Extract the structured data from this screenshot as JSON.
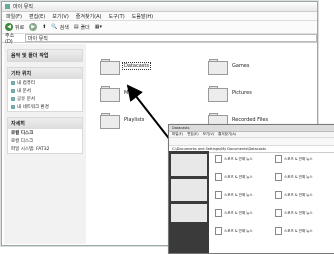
{
  "window": {
    "title": "마이 뮤직",
    "menu": [
      "파일(F)",
      "편집(E)",
      "보기(V)",
      "즐겨찾기(A)",
      "도구(T)",
      "도움말(H)"
    ],
    "toolbar": {
      "back": "뒤로",
      "search": "검색",
      "folders": "폴더"
    },
    "address_label": "주소(D)",
    "address_value": "마이 뮤직"
  },
  "sidebar": {
    "tasks_title": "음악 및 폴더 작업",
    "places_title": "기타 위치",
    "places": [
      "내 컴퓨터",
      "내 문서",
      "공유 문서",
      "내 네트워크 환경"
    ],
    "details_title": "자세히",
    "details_name": "로컬 디스크",
    "details_sub": "로컬 디스크",
    "details_fs": "파일 시스템: FAT32"
  },
  "folders": [
    {
      "label": "Datacasts",
      "selected": true
    },
    {
      "label": "Games",
      "selected": false
    },
    {
      "label": "Music",
      "selected": false
    },
    {
      "label": "Pictures",
      "selected": false
    },
    {
      "label": "Playlists",
      "selected": false
    },
    {
      "label": "Recorded Files",
      "selected": false
    }
  ],
  "inset": {
    "title": "Datacasts",
    "address": "C:\\Documents and Settings\\My Documents\\Datacasts",
    "files": [
      "스포츠 & 연예 뉴스",
      "스포츠 & 연예 뉴스",
      "스포츠 & 연예 뉴스",
      "스포츠 & 연예 뉴스",
      "스포츠 & 연예 뉴스",
      "스포츠 & 연예 뉴스",
      "스포츠 & 연예 뉴스",
      "스포츠 & 연예 뉴스",
      "스포츠 & 연예 뉴스",
      "스포츠 & 연예 뉴스"
    ]
  }
}
